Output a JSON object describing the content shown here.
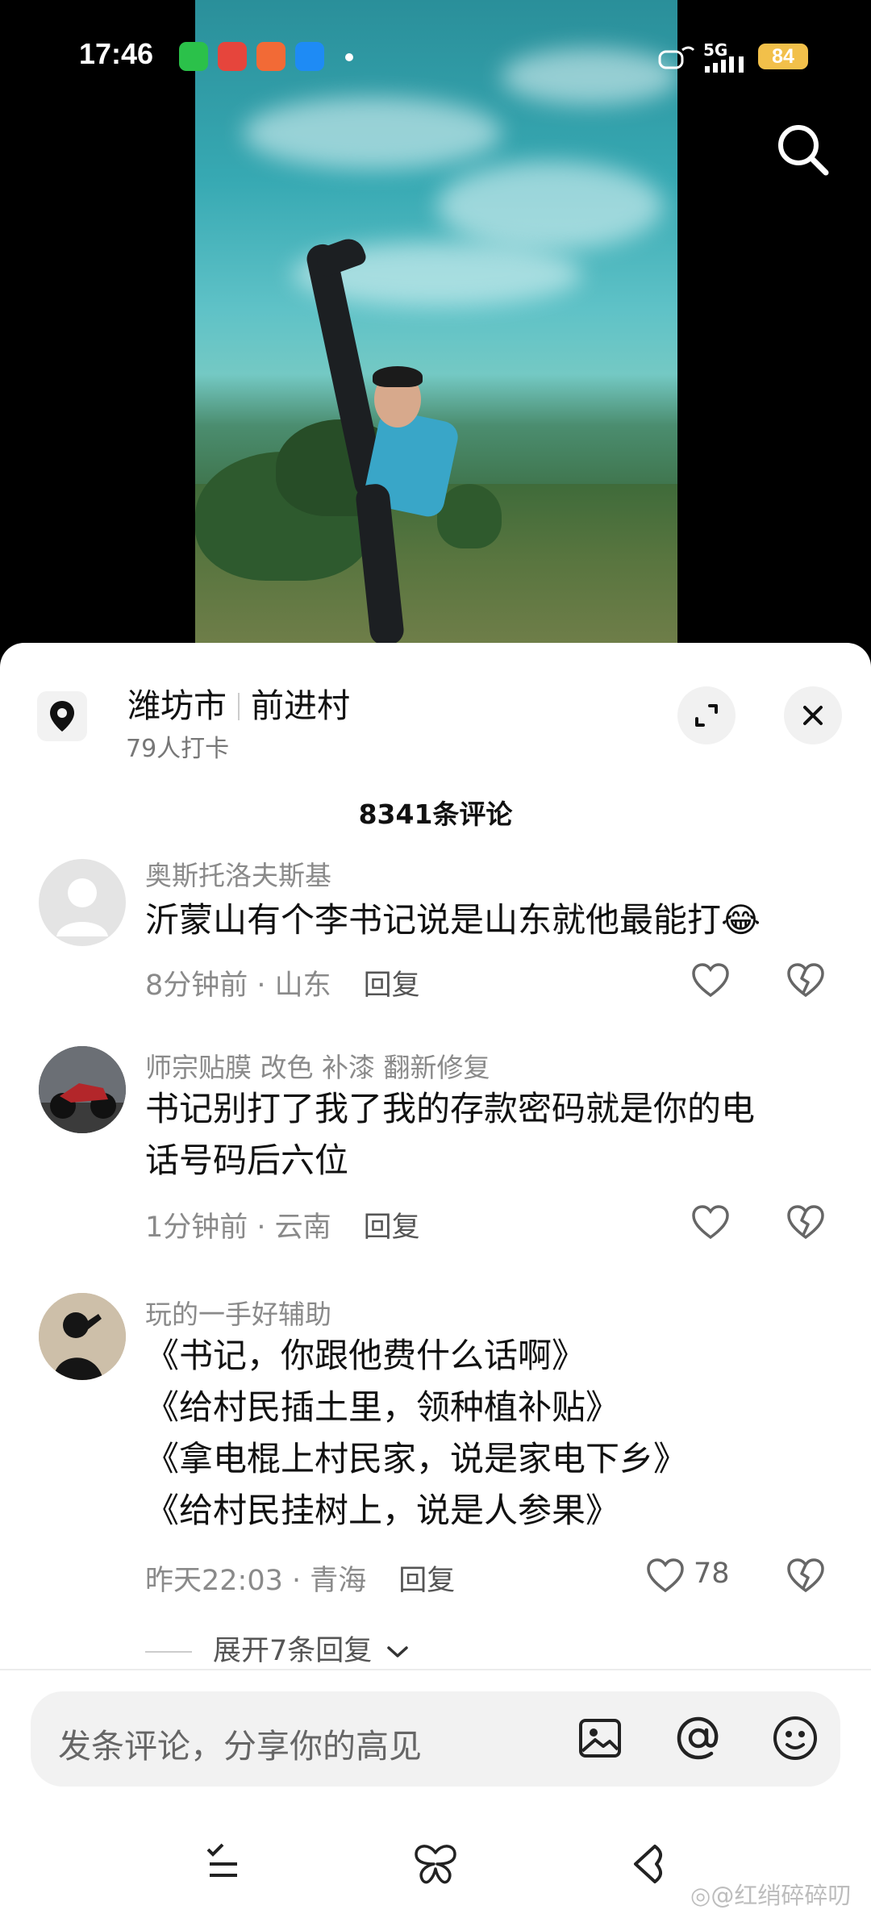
{
  "status_bar": {
    "time": "17:46",
    "network": "5G",
    "battery": "84"
  },
  "location": {
    "city": "潍坊市",
    "village": "前进村",
    "checkins": "79人打卡"
  },
  "comments_header": {
    "count_label": "8341条评论"
  },
  "comments": [
    {
      "user": "奥斯托洛夫斯基",
      "text": "沂蒙山有个李书记说是山东就他最能打😂",
      "time_loc": "8分钟前 · 山东",
      "reply_label": "回复",
      "likes": ""
    },
    {
      "user": "师宗贴膜  改色   补漆  翻新修复",
      "text_lines": [
        "书记别打了我了我的存款密码就是你的电",
        "话号码后六位"
      ],
      "time_loc": "1分钟前 · 云南",
      "reply_label": "回复",
      "likes": ""
    },
    {
      "user": "玩的一手好辅助",
      "text_lines": [
        "《书记，你跟他费什么话啊》",
        "《给村民插土里，领种植补贴》",
        "《拿电棍上村民家，说是家电下乡》",
        "《给村民挂树上，说是人参果》"
      ],
      "time_loc": "昨天22:03 · 青海",
      "reply_label": "回复",
      "likes": "78"
    }
  ],
  "expand_replies": "展开7条回复",
  "input": {
    "placeholder": "发条评论，分享你的高见"
  },
  "watermark": "@红绡碎碎叨",
  "icons": {
    "search": "search-icon",
    "location": "location-pin-icon",
    "expand": "expand-icon",
    "close": "close-icon",
    "like": "heart-icon",
    "dislike": "broken-heart-icon",
    "image": "image-icon",
    "mention": "at-icon",
    "emoji": "emoji-icon"
  },
  "colors": {
    "accent_text": "#111111",
    "muted_text": "#8a8a8a",
    "battery": "#f2c04a"
  }
}
